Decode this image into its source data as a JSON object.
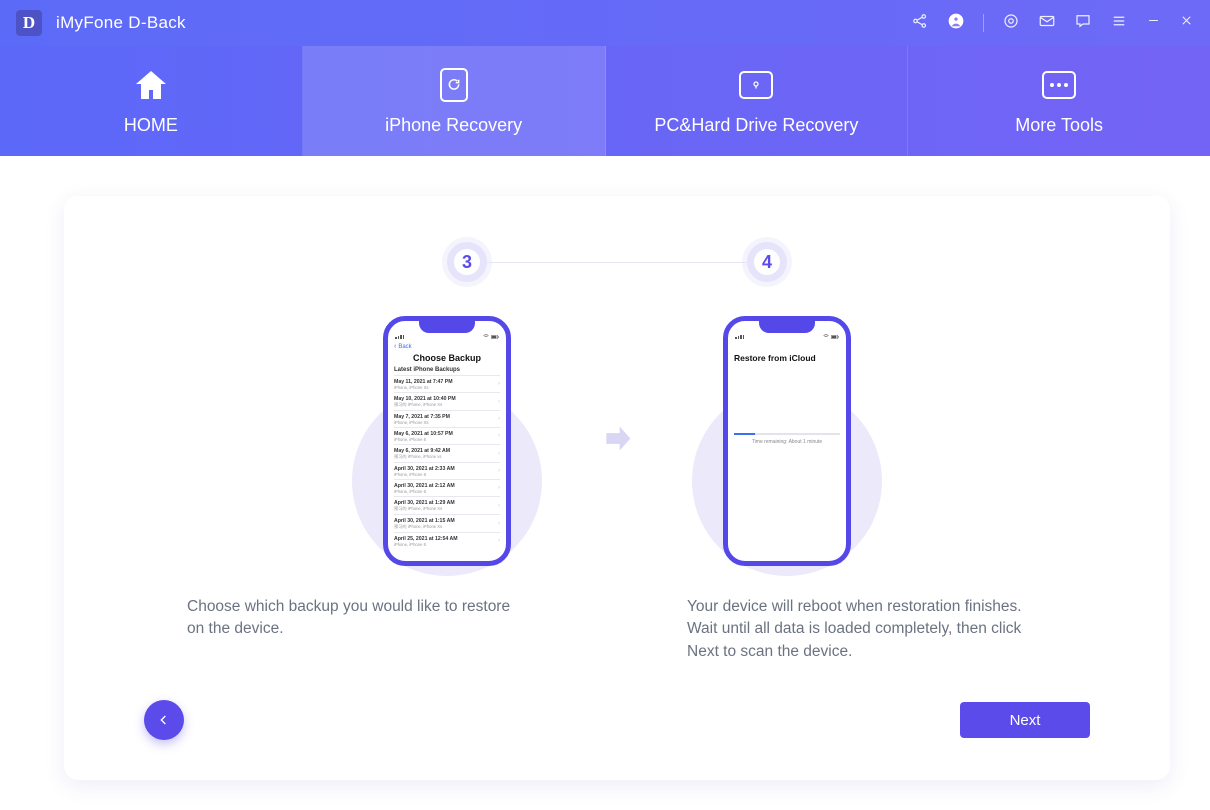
{
  "titlebar": {
    "logo_letter": "D",
    "app_title": "iMyFone D-Back"
  },
  "nav": {
    "home": "HOME",
    "iphone_recovery": "iPhone Recovery",
    "pc_recovery": "PC&Hard Drive Recovery",
    "more_tools": "More Tools"
  },
  "steps": {
    "step3": "3",
    "step4": "4"
  },
  "phone1": {
    "back": "Back",
    "title": "Choose Backup",
    "subtitle": "Latest iPhone Backups",
    "items": [
      {
        "line1": "May 11, 2021 at 7:47 PM",
        "line2": "iPhone, iPhone Xs"
      },
      {
        "line1": "May 10, 2021 at 10:40 PM",
        "line2": "预习的 iPhone, iPhone Xs"
      },
      {
        "line1": "May 7, 2021 at 7:35 PM",
        "line2": "iPhone, iPhone Xs"
      },
      {
        "line1": "May 6, 2021 at 10:57 PM",
        "line2": "iPhone, iPhone 8"
      },
      {
        "line1": "May 6, 2021 at 9:42 AM",
        "line2": "预习的 iPhone, iPhone xs"
      },
      {
        "line1": "April 30, 2021 at 2:33 AM",
        "line2": "iPhone, iPhone 8"
      },
      {
        "line1": "April 30, 2021 at 2:12 AM",
        "line2": "iPhone, iPhone 8"
      },
      {
        "line1": "April 30, 2021 at 1:29 AM",
        "line2": "预习的 iPhone, iPhone Xs"
      },
      {
        "line1": "April 30, 2021 at 1:15 AM",
        "line2": "预习的 iPhone, iPhone Xs"
      },
      {
        "line1": "April 25, 2021 at 12:54 AM",
        "line2": "iPhone, iPhone 8"
      }
    ]
  },
  "phone2": {
    "title": "Restore from iCloud",
    "remaining": "Time remaining: About 1 minute"
  },
  "captions": {
    "left": "Choose which backup you would like to restore on the device.",
    "right": "Your device will reboot when restoration finishes.\nWait until all data is loaded completely, then click Next to scan the device."
  },
  "buttons": {
    "next": "Next"
  }
}
